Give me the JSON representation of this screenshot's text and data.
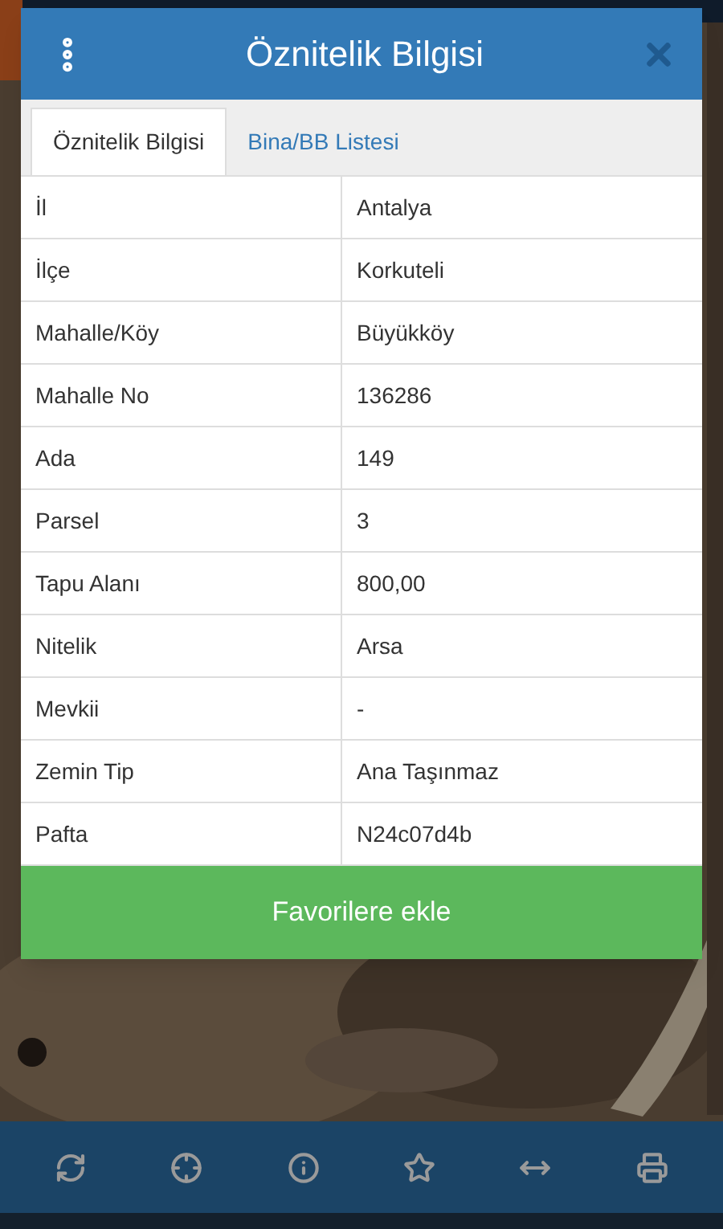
{
  "dialog": {
    "title": "Öznitelik Bilgisi"
  },
  "tabs": [
    {
      "label": "Öznitelik Bilgisi",
      "selected": true
    },
    {
      "label": "Bina/BB Listesi",
      "selected": false
    }
  ],
  "table": {
    "rows": [
      {
        "label": "İl",
        "value": "Antalya"
      },
      {
        "label": "İlçe",
        "value": "Korkuteli"
      },
      {
        "label": "Mahalle/Köy",
        "value": "Büyükköy"
      },
      {
        "label": "Mahalle No",
        "value": "136286"
      },
      {
        "label": "Ada",
        "value": "149"
      },
      {
        "label": "Parsel",
        "value": "3"
      },
      {
        "label": "Tapu Alanı",
        "value": "800,00"
      },
      {
        "label": "Nitelik",
        "value": "Arsa"
      },
      {
        "label": "Mevkii",
        "value": "-"
      },
      {
        "label": "Zemin Tip",
        "value": "Ana Taşınmaz"
      },
      {
        "label": "Pafta",
        "value": "N24c07d4b"
      }
    ]
  },
  "action_button": {
    "label": "Favorilere ekle"
  }
}
